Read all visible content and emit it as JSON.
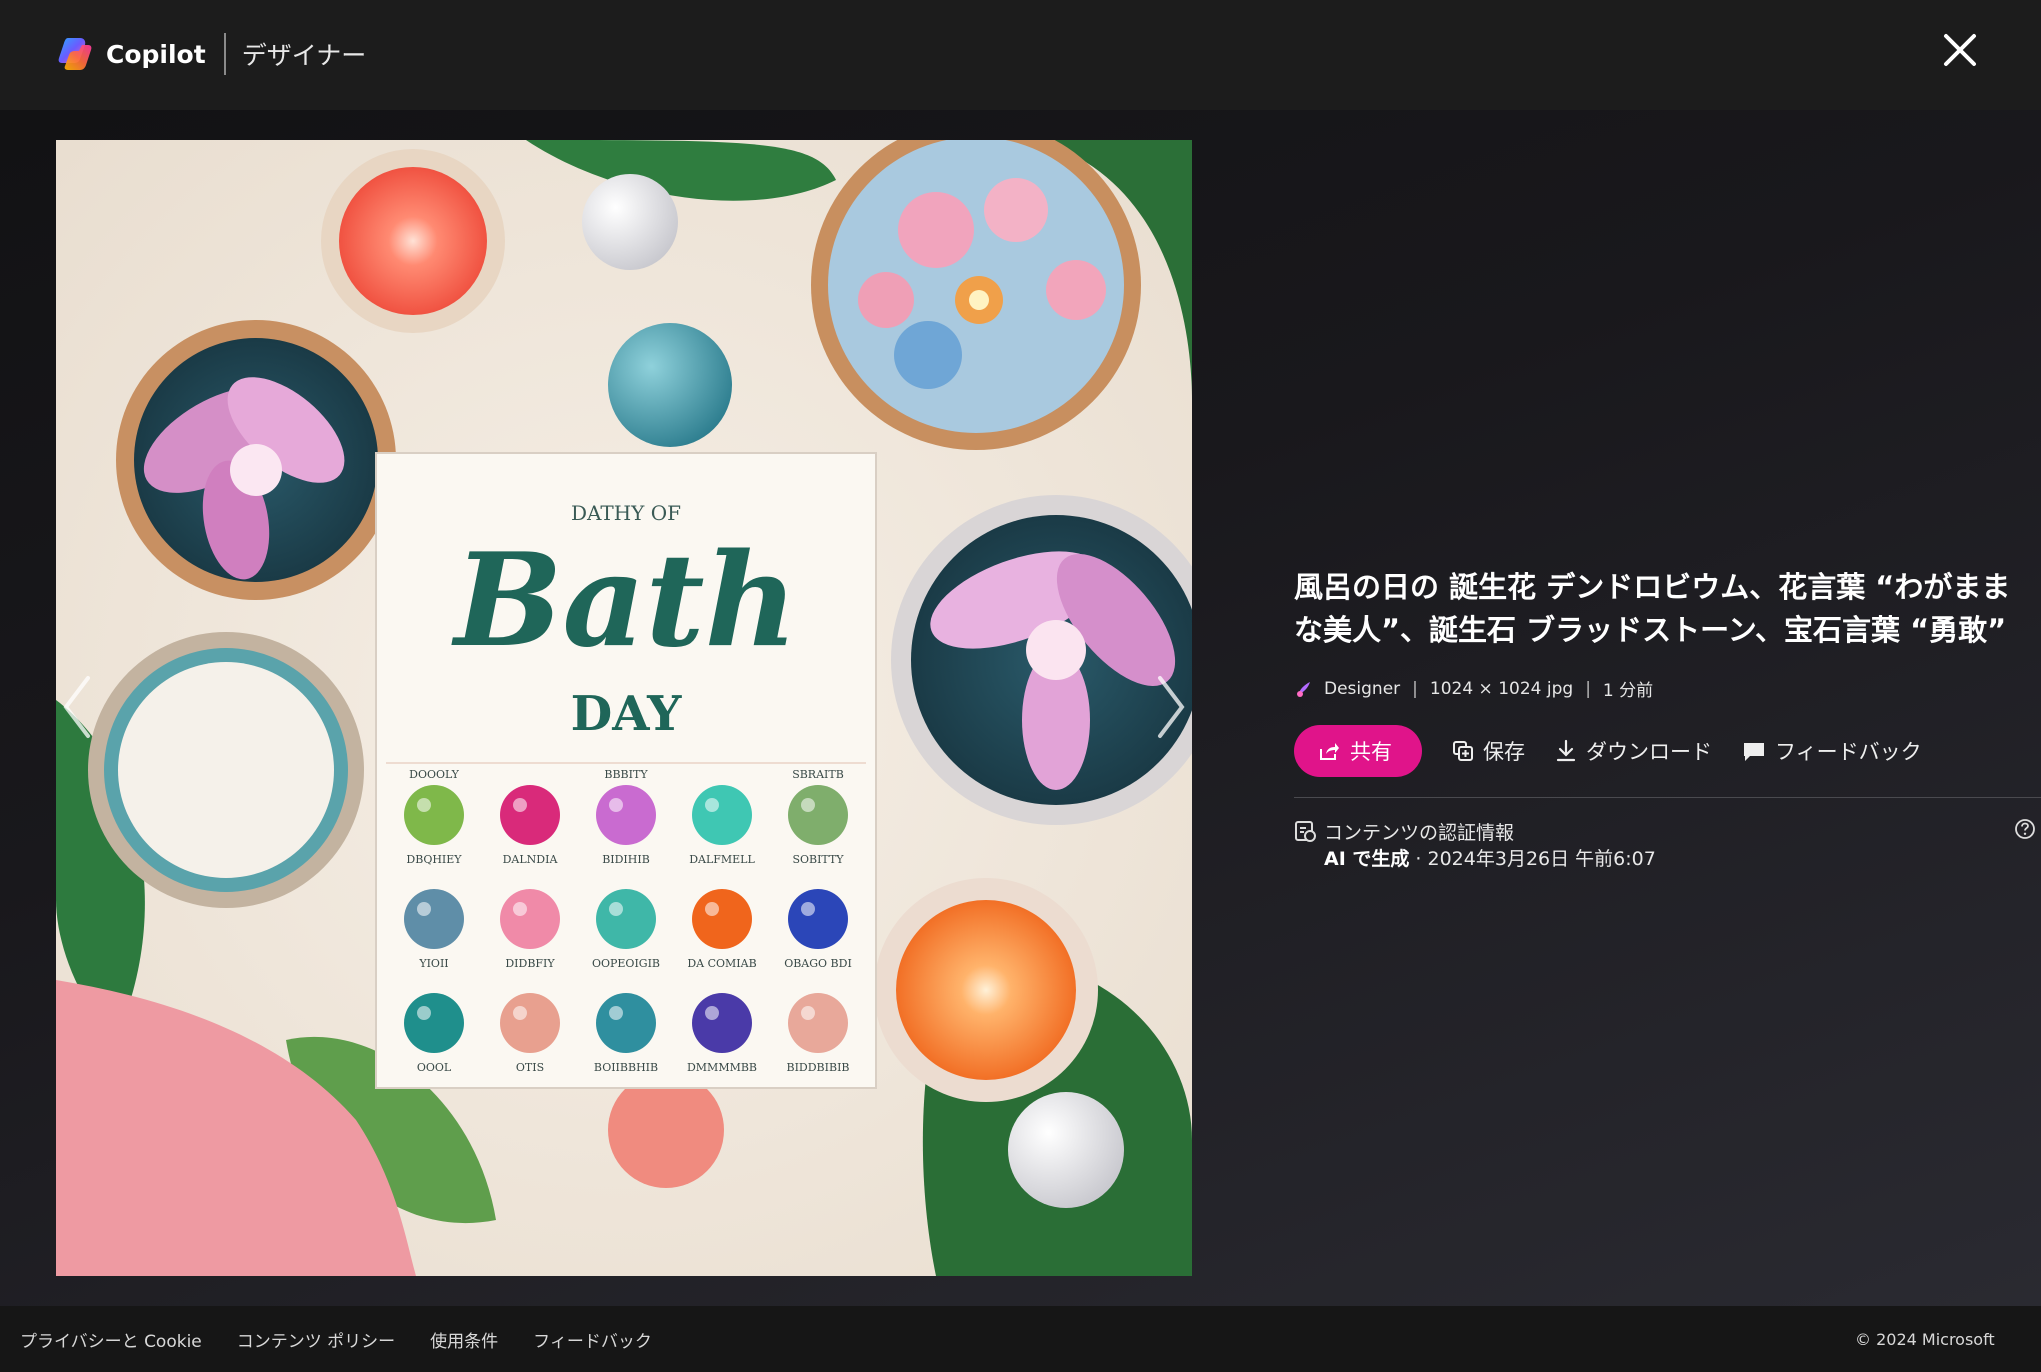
{
  "header": {
    "brand_name": "Copilot",
    "brand_sub": "デザイナー",
    "close_label": "×"
  },
  "image": {
    "card_top_text": "DATHY OF",
    "card_main_text": "Bath",
    "card_sub_text": "DAY",
    "grid_labels": [
      "DOOOLY",
      "",
      "BBBITY",
      "",
      "SBRAITB",
      "DBQHIEY",
      "DALNDIA",
      "BIDIHIB",
      "DALFMELL",
      "SOBITTY",
      "YIOII",
      "DIDBFIY",
      "OOPEOIGIB",
      "DA COMIAB",
      "OBAGO BDI",
      "OOOL",
      "OTIS",
      "BOIIBBHIB",
      "DMMMMBB",
      "BIDDBIBIB"
    ]
  },
  "info": {
    "title": "風呂の日の 誕生花 デンドロビウム、花言葉 “わがままな美人”、誕生石 ブラッドストーン、宝石言葉 “勇敢”",
    "meta_source": "Designer",
    "meta_size": "1024 × 1024 jpg",
    "meta_time": "1 分前",
    "actions": {
      "share": "共有",
      "save": "保存",
      "download": "ダウンロード",
      "feedback": "フィードバック"
    },
    "credentials_title": "コンテンツの認証情報",
    "credentials_ai": "AI で生成",
    "credentials_date": " · 2024年3月26日 午前6:07"
  },
  "footer": {
    "links": [
      "プライバシーと Cookie",
      "コンテンツ ポリシー",
      "使用条件",
      "フィードバック"
    ],
    "copyright": "© 2024 Microsoft"
  },
  "colors": {
    "accent": "#e0148a",
    "background": "#1b1a1d",
    "topbar": "#1c1c1c",
    "footer": "#161616"
  },
  "icons": [
    "copilot-logo-icon",
    "close-icon",
    "chevron-left-icon",
    "chevron-right-icon",
    "designer-icon",
    "share-icon",
    "save-icon",
    "download-icon",
    "feedback-icon",
    "credentials-icon",
    "help-icon"
  ]
}
